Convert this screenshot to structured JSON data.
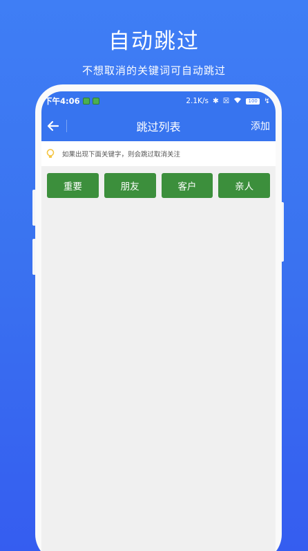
{
  "hero": {
    "title": "自动跳过",
    "subtitle": "不想取消的关键词可自动跳过"
  },
  "statusbar": {
    "time": "下午4:06",
    "network_speed": "2.1K/s",
    "battery": "100"
  },
  "appbar": {
    "back_icon": "arrow-left-icon",
    "title": "跳过列表",
    "action_label": "添加"
  },
  "tip": {
    "icon": "lightbulb-icon",
    "text": "如果出现下面关键字，则会跳过取消关注"
  },
  "keywords": [
    {
      "label": "重要"
    },
    {
      "label": "朋友"
    },
    {
      "label": "客户"
    },
    {
      "label": "亲人"
    }
  ],
  "colors": {
    "background": "#3a73f0",
    "app_accent": "#3774ef",
    "tag_green": "#3c8f3c",
    "bulb_yellow": "#f5c542"
  }
}
